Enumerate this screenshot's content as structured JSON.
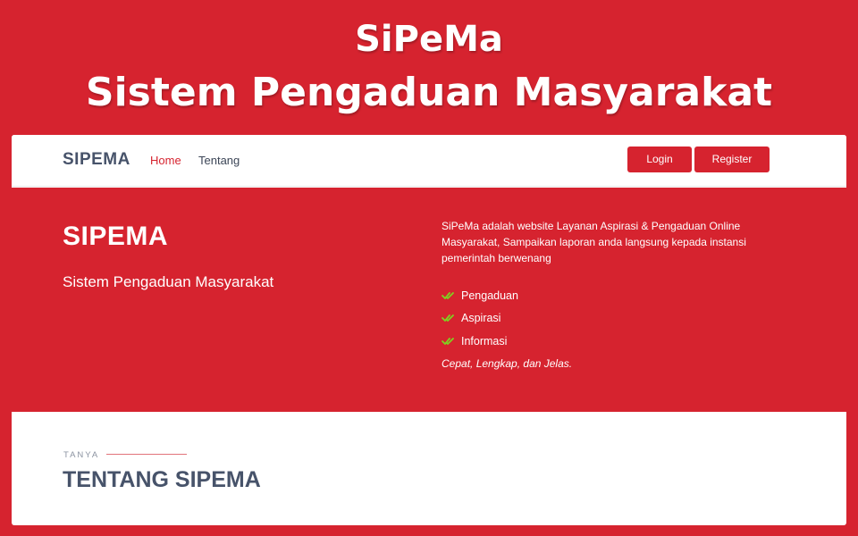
{
  "banner": {
    "line1": "SiPeMa",
    "line2": "Sistem Pengaduan Masyarakat"
  },
  "navbar": {
    "brand": "SIPEMA",
    "links": [
      {
        "label": "Home",
        "active": true
      },
      {
        "label": "Tentang",
        "active": false
      }
    ],
    "login_label": "Login",
    "register_label": "Register"
  },
  "hero": {
    "title": "SIPEMA",
    "subtitle": "Sistem Pengaduan Masyarakat",
    "description": "SiPeMa adalah website Layanan Aspirasi & Pengaduan Online Masyarakat, Sampaikan laporan anda langsung kepada instansi pemerintah berwenang",
    "features": [
      "Pengaduan",
      "Aspirasi",
      "Informasi"
    ],
    "tagline": "Cepat, Lengkap, dan Jelas."
  },
  "about": {
    "eyebrow": "TANYA",
    "title": "TENTANG SIPEMA"
  },
  "colors": {
    "accent": "#d6232f",
    "check": "#7ed321",
    "text_dark": "#47536a"
  },
  "icons": {
    "feature": "double-check-icon"
  }
}
